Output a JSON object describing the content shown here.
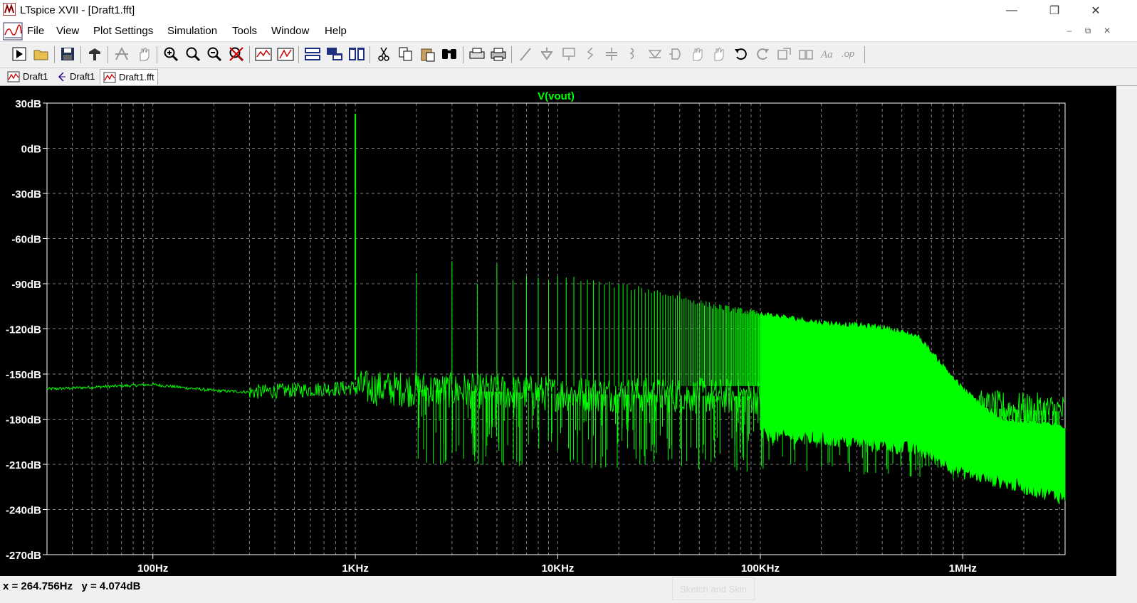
{
  "window": {
    "title": "LTspice XVII - [Draft1.fft]",
    "controls": [
      "minimize-icon",
      "restore-icon",
      "close-icon"
    ]
  },
  "menu": {
    "items": [
      "File",
      "View",
      "Plot Settings",
      "Simulation",
      "Tools",
      "Window",
      "Help"
    ]
  },
  "toolbar": {
    "buttons": [
      "run-icon",
      "open-icon",
      "save-icon",
      "control-panel-icon",
      "autorange-icon",
      "pan-icon",
      "zoom-in-icon",
      "zoom-area-icon",
      "zoom-out-icon",
      "zoom-cancel-icon",
      "autoscale-icon",
      "fit-icon",
      "tile-horizontal-icon",
      "cascade-icon",
      "tile-vertical-icon",
      "cut-icon",
      "copy-icon",
      "paste-icon",
      "find-icon",
      "print-preview-icon",
      "print-icon",
      "wire-icon",
      "ground-icon",
      "label-icon",
      "resistor-icon",
      "capacitor-icon",
      "inductor-icon",
      "diode-icon",
      "component-icon",
      "move-icon",
      "drag-icon",
      "undo-icon",
      "redo-icon",
      "rotate-icon",
      "mirror-icon",
      "text-icon",
      "spice-directive-icon"
    ]
  },
  "tabs": [
    {
      "label": "Draft1",
      "icon": "waveform-icon",
      "active": false
    },
    {
      "label": "Draft1",
      "icon": "schematic-icon",
      "active": false
    },
    {
      "label": "Draft1.fft",
      "icon": "waveform-icon",
      "active": true
    }
  ],
  "plot": {
    "trace_name": "V(vout)",
    "trace_color": "#00ff00",
    "background": "#000000",
    "grid_color": "#808080"
  },
  "chart_data": {
    "type": "line",
    "title": "V(vout)",
    "xlabel": "",
    "ylabel": "",
    "xscale": "log",
    "xlim": [
      30,
      3200000
    ],
    "ylim": [
      -270,
      30
    ],
    "x_ticks": [
      "100Hz",
      "1KHz",
      "10KHz",
      "100KHz",
      "1MHz"
    ],
    "x_tick_values": [
      100,
      1000,
      10000,
      100000,
      1000000
    ],
    "y_ticks": [
      "30dB",
      "0dB",
      "-30dB",
      "-60dB",
      "-90dB",
      "-120dB",
      "-150dB",
      "-180dB",
      "-210dB",
      "-240dB",
      "-270dB"
    ],
    "y_tick_values": [
      30,
      0,
      -30,
      -60,
      -90,
      -120,
      -150,
      -180,
      -210,
      -240,
      -270
    ],
    "grid": true,
    "series": [
      {
        "name": "V(vout)",
        "color": "#00ff00",
        "noise_floor": [
          [
            30,
            -160
          ],
          [
            100,
            -157
          ],
          [
            200,
            -161
          ],
          [
            300,
            -162
          ],
          [
            1000,
            -159
          ],
          [
            10000,
            -163
          ],
          [
            100000,
            -165
          ],
          [
            500000,
            -168
          ],
          [
            1000000,
            -172
          ],
          [
            3200000,
            -175
          ]
        ],
        "harmonic_peaks": [
          [
            1000,
            23
          ],
          [
            2000,
            -83
          ],
          [
            3000,
            -75
          ],
          [
            4000,
            -90
          ],
          [
            5000,
            -77
          ],
          [
            6000,
            -88
          ],
          [
            7000,
            -85
          ],
          [
            8000,
            -86
          ],
          [
            9000,
            -88
          ],
          [
            10000,
            -85
          ],
          [
            12000,
            -90
          ],
          [
            15000,
            -89
          ],
          [
            20000,
            -90
          ],
          [
            30000,
            -95
          ],
          [
            40000,
            -96
          ],
          [
            60000,
            -105
          ],
          [
            100000,
            -110
          ]
        ],
        "envelope_upper": [
          [
            100000,
            -110
          ],
          [
            200000,
            -116
          ],
          [
            400000,
            -119
          ],
          [
            600000,
            -125
          ],
          [
            1000000,
            -160
          ],
          [
            1500000,
            -180
          ],
          [
            3200000,
            -185
          ]
        ],
        "envelope_lower": [
          [
            100000,
            -190
          ],
          [
            300000,
            -195
          ],
          [
            600000,
            -200
          ],
          [
            1000000,
            -215
          ],
          [
            2000000,
            -225
          ],
          [
            3200000,
            -232
          ]
        ]
      }
    ]
  },
  "status": {
    "cursor": "x = 264.756Hz   y = 4.074dB",
    "ghost": "Sketch and Skin"
  }
}
